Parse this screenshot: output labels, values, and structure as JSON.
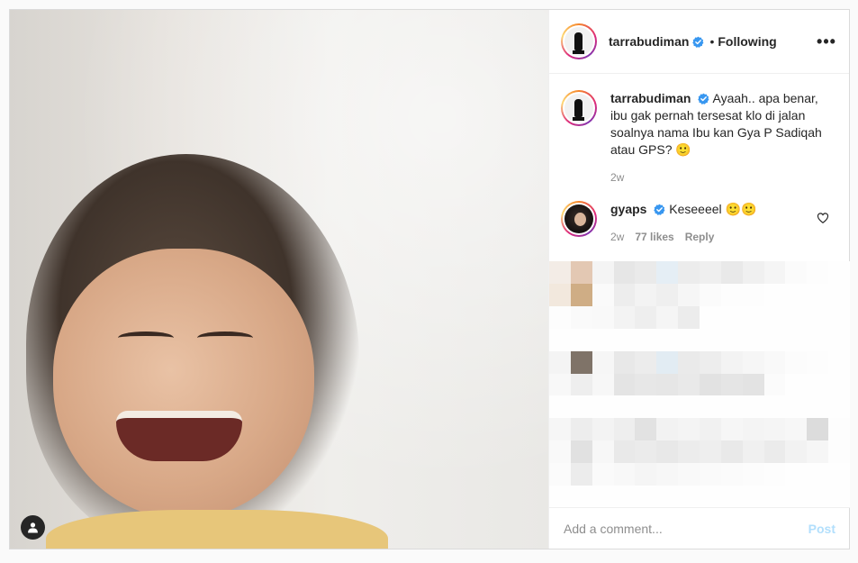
{
  "post": {
    "author": {
      "username": "tarrabudiman",
      "follow_status": "Following",
      "more_label": "•••"
    },
    "caption": {
      "username": "tarrabudiman",
      "text": "Ayaah.. apa benar, ibu gak pernah tersesat klo di jalan soalnya nama Ibu kan Gya P Sadiqah atau GPS? 🙂",
      "time": "2w"
    },
    "comments": [
      {
        "username": "gyaps",
        "text": "Keseeeel 🙂🙂",
        "time": "2w",
        "likes": "77 likes",
        "reply_label": "Reply"
      }
    ],
    "add_comment": {
      "placeholder": "Add a comment...",
      "post_label": "Post"
    }
  },
  "colors": {
    "verified": "#3897f0",
    "post_button_disabled": "#b2dffc",
    "muted_text": "#8e8e8e"
  },
  "icons": {
    "verified": "verified-badge-icon",
    "tag": "user-tag-icon",
    "heart": "heart-outline-icon",
    "more": "more-horizontal-icon"
  }
}
